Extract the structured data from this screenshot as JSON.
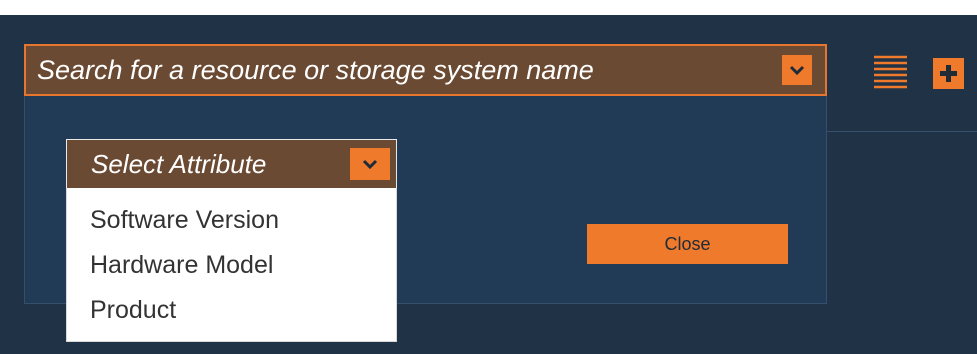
{
  "search": {
    "placeholder": "Search for a resource or storage system name",
    "toggle_icon": "chevron-down-icon"
  },
  "header": {
    "list_view_icon": "list-lines-icon",
    "add_icon": "plus-icon"
  },
  "filter_panel": {
    "attribute_select": {
      "selected_label": "Select Attribute",
      "options": [
        "Software Version",
        "Hardware Model",
        "Product"
      ]
    },
    "close_label": "Close"
  },
  "colors": {
    "background": "#1f3246",
    "panel": "#213b56",
    "accent": "#f07a2b",
    "select_fill": "#6b4a33",
    "option_text": "#333333"
  }
}
